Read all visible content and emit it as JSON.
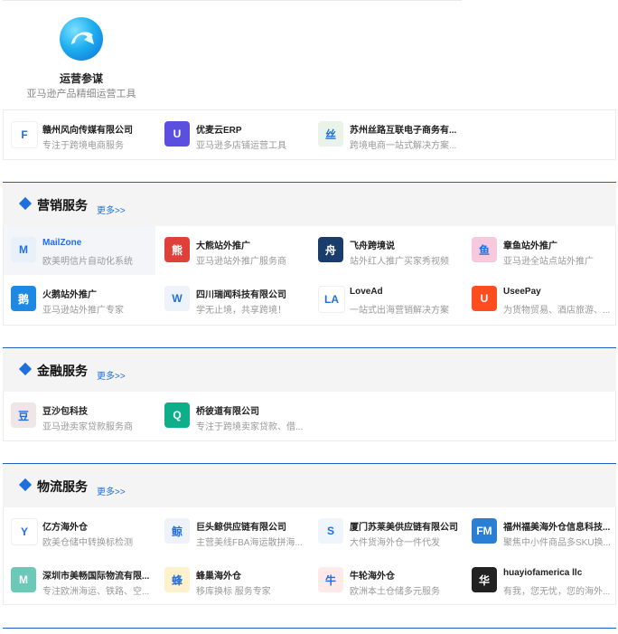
{
  "featured": {
    "title": "运营参谋",
    "subtitle": "亚马逊产品精细运营工具"
  },
  "top_items": [
    {
      "name": "赣州风向传媒有限公司",
      "desc": "专注于跨境电商服务",
      "icon": "fengxiang-logo-icon",
      "color": "#ffffff",
      "glyph": "F"
    },
    {
      "name": "优麦云ERP",
      "desc": "亚马逊多店铺运营工具",
      "icon": "youmai-logo-icon",
      "color": "#5b4fe0",
      "glyph": "U"
    },
    {
      "name": "苏州丝路互联电子商务有...",
      "desc": "跨境电商一站式解决方案...",
      "icon": "silu-logo-icon",
      "color": "#e9f3ea",
      "glyph": "丝"
    }
  ],
  "sections": [
    {
      "title": "营销服务",
      "more": "更多>>",
      "items": [
        {
          "name": "MailZone",
          "desc": "欧美明信片自动化系统",
          "icon": "mailzone-logo-icon",
          "color": "#e8f0fa",
          "glyph": "M",
          "active": true
        },
        {
          "name": "大熊站外推广",
          "desc": "亚马逊站外推广服务商",
          "icon": "bear-logo-icon",
          "color": "#e0403a",
          "glyph": "熊"
        },
        {
          "name": "飞舟跨境说",
          "desc": "站外红人推广买家秀视频",
          "icon": "feizhou-logo-icon",
          "color": "#1a3d6b",
          "glyph": "舟"
        },
        {
          "name": "章鱼站外推广",
          "desc": "亚马逊全站点站外推广",
          "icon": "octopus-logo-icon",
          "color": "#f7c9de",
          "glyph": "鱼"
        },
        {
          "name": "火鹅站外推广",
          "desc": "亚马逊站外推广专家",
          "icon": "huoe-logo-icon",
          "color": "#1e88e5",
          "glyph": "鹅"
        },
        {
          "name": "四川瑞闻科技有限公司",
          "desc": "学无止境，共享跨境！",
          "icon": "ruiwen-logo-icon",
          "color": "#eef2fb",
          "glyph": "W"
        },
        {
          "name": "LoveAd",
          "desc": "一站式出海营销解决方案",
          "icon": "lovead-logo-icon",
          "color": "#ffffff",
          "glyph": "LA"
        },
        {
          "name": "UseePay",
          "desc": "为货物贸易、酒店旅游、...",
          "icon": "useepay-logo-icon",
          "color": "#ff4d1f",
          "glyph": "U"
        }
      ]
    },
    {
      "title": "金融服务",
      "more": "更多>>",
      "items": [
        {
          "name": "豆沙包科技",
          "desc": "亚马逊卖家贷款服务商",
          "icon": "doushabao-logo-icon",
          "color": "#f1e6e6",
          "glyph": "豆"
        },
        {
          "name": "桥彼道有限公司",
          "desc": "专注于跨境卖家贷款、借...",
          "icon": "qiaobidao-logo-icon",
          "color": "#0fae8a",
          "glyph": "Q"
        }
      ]
    },
    {
      "title": "物流服务",
      "more": "更多>>",
      "items": [
        {
          "name": "亿方海外仓",
          "desc": "欧美仓储中转换标检测",
          "icon": "yifang-logo-icon",
          "color": "#ffffff",
          "glyph": "Y"
        },
        {
          "name": "巨头鲸供应链有限公司",
          "desc": "主营美线FBA海运散拼海...",
          "icon": "jutoujing-logo-icon",
          "color": "#eef3fb",
          "glyph": "鲸"
        },
        {
          "name": "厦门苏莱美供应链有限公司",
          "desc": "大件货海外仓一件代发",
          "icon": "sulaimei-logo-icon",
          "color": "#eef6fb",
          "glyph": "S"
        },
        {
          "name": "福州福美海外仓信息科技...",
          "desc": "聚焦中小件商品多SKU换...",
          "icon": "fumei-logo-icon",
          "color": "#2a7fd4",
          "glyph": "FM"
        },
        {
          "name": "深圳市美畅国际物流有限...",
          "desc": "专注欧洲海运、铁路、空...",
          "icon": "meichang-logo-icon",
          "color": "#6cc9b8",
          "glyph": "M"
        },
        {
          "name": "蜂巢海外仓",
          "desc": "移库换标 服务专家",
          "icon": "fengchao-logo-icon",
          "color": "#fff1cc",
          "glyph": "蜂"
        },
        {
          "name": "牛轮海外仓",
          "desc": "欧洲本土仓储多元服务",
          "icon": "niulun-logo-icon",
          "color": "#ffe9e9",
          "glyph": "牛"
        },
        {
          "name": "huayiofamerica llc",
          "desc": "有我，您无忧，您的海外...",
          "icon": "huayi-logo-icon",
          "color": "#222222",
          "glyph": "华"
        }
      ]
    }
  ]
}
